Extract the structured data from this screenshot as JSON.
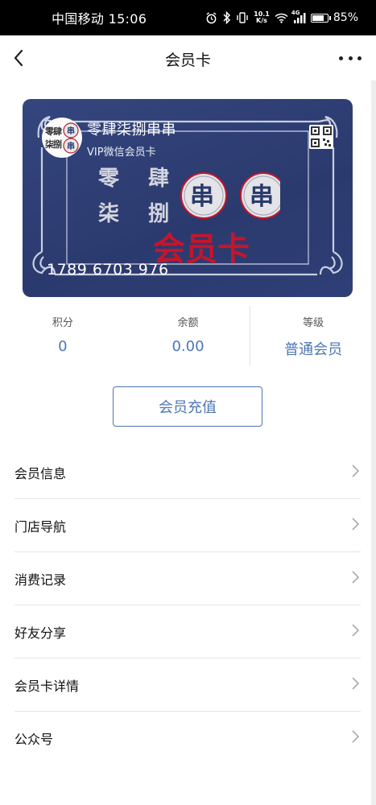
{
  "status_bar": {
    "carrier_time": "中国移动 15:06",
    "net_speed_value": "10.1",
    "net_speed_unit": "K/s",
    "signal_label": "4G",
    "battery_text": "85%",
    "battery_level": 0.85
  },
  "nav": {
    "title": "会员卡",
    "back_icon": "chevron-left-icon",
    "more_icon": "more-dots-icon"
  },
  "card": {
    "brand_name": "零肆柒捌串串",
    "subtitle": "VIP微信会员卡",
    "logo_chars": [
      "零",
      "肆",
      "柒",
      "捌",
      "串",
      "串"
    ],
    "art_chars": [
      "零",
      "肆",
      "柒",
      "捌",
      "串",
      "串"
    ],
    "art_title": "会员卡",
    "card_number": "1789 6703 976",
    "qr_icon": "qr-code-icon",
    "colors": {
      "background": "#2f4077",
      "art_red": "#c8142a",
      "frame": "#c9cfe0"
    }
  },
  "stats": [
    {
      "label": "积分",
      "value": "0"
    },
    {
      "label": "余额",
      "value": "0.00"
    },
    {
      "label": "等级",
      "value": "普通会员"
    }
  ],
  "recharge_label": "会员充值",
  "menu": [
    {
      "label": "会员信息"
    },
    {
      "label": "门店导航"
    },
    {
      "label": "消费记录"
    },
    {
      "label": "好友分享"
    },
    {
      "label": "会员卡详情"
    },
    {
      "label": "公众号"
    }
  ],
  "accent_color": "#4d76b3"
}
